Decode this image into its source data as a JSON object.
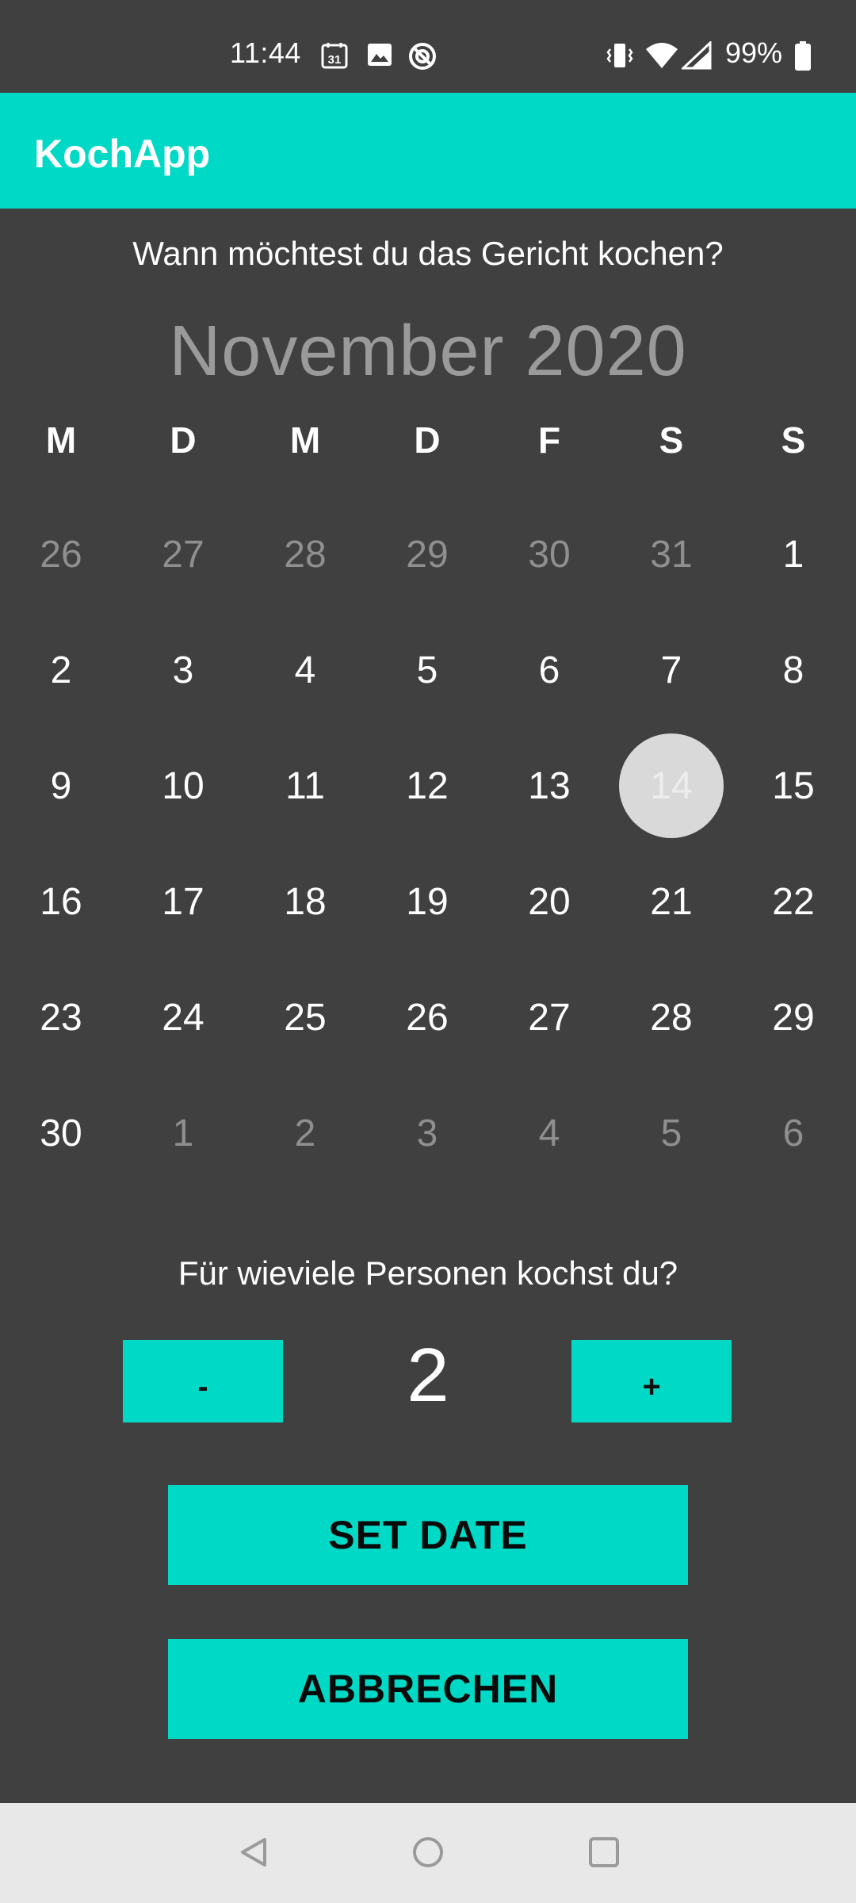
{
  "status_bar": {
    "time": "11:44",
    "calendar_badge": "31",
    "battery": "99%",
    "icons": [
      "calendar-icon",
      "image-icon",
      "data-saver-icon",
      "vibrate-icon",
      "wifi-icon",
      "signal-icon",
      "battery-icon"
    ]
  },
  "app_bar": {
    "title": "KochApp"
  },
  "date_question": "Wann möchtest du das Gericht kochen?",
  "calendar": {
    "month_label": "November 2020",
    "weekdays": [
      "M",
      "D",
      "M",
      "D",
      "F",
      "S",
      "S"
    ],
    "selected_day": "14",
    "weeks": [
      [
        "26",
        "27",
        "28",
        "29",
        "30",
        "31",
        "1"
      ],
      [
        "2",
        "3",
        "4",
        "5",
        "6",
        "7",
        "8"
      ],
      [
        "9",
        "10",
        "11",
        "12",
        "13",
        "14",
        "15"
      ],
      [
        "16",
        "17",
        "18",
        "19",
        "20",
        "21",
        "22"
      ],
      [
        "23",
        "24",
        "25",
        "26",
        "27",
        "28",
        "29"
      ],
      [
        "30",
        "1",
        "2",
        "3",
        "4",
        "5",
        "6"
      ]
    ]
  },
  "persons_question": "Für wieviele Personen kochst du?",
  "stepper": {
    "minus_label": "-",
    "count": "2",
    "plus_label": "+"
  },
  "buttons": {
    "set_date": "SET DATE",
    "cancel": "ABBRECHEN"
  },
  "colors": {
    "accent": "#00D9C5",
    "background": "#404040",
    "muted_day": "#8f8f8f",
    "selected_circle": "#d9d9d9"
  }
}
